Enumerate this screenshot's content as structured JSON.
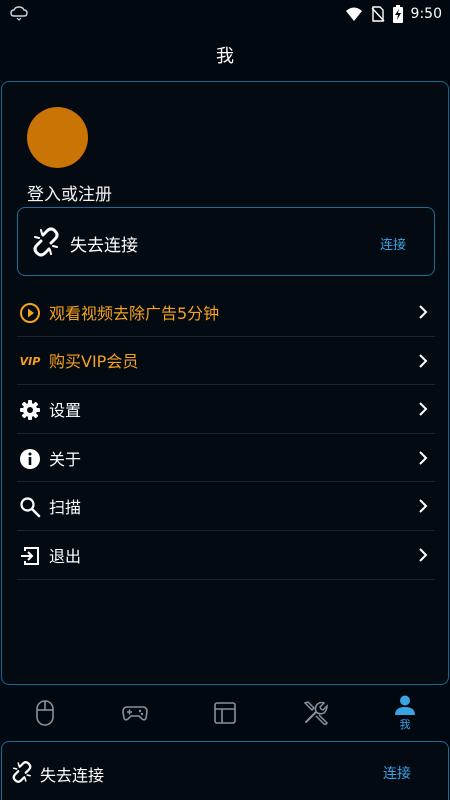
{
  "status_bar": {
    "time": "9:50"
  },
  "header": {
    "title": "我"
  },
  "profile": {
    "login_text": "登入或注册"
  },
  "connection": {
    "status": "失去连接",
    "action": "连接"
  },
  "menu": [
    {
      "label": "观看视频去除广告5分钟",
      "icon": "play-circle-icon",
      "color": "#f6a21c"
    },
    {
      "label": "购买VIP会员",
      "icon": "vip-icon",
      "color": "#f6a21c"
    },
    {
      "label": "设置",
      "icon": "gear-icon",
      "color": "#ffffff"
    },
    {
      "label": "关于",
      "icon": "info-icon",
      "color": "#ffffff"
    },
    {
      "label": "扫描",
      "icon": "search-icon",
      "color": "#ffffff"
    },
    {
      "label": "退出",
      "icon": "logout-icon",
      "color": "#ffffff"
    }
  ],
  "vip_badge": "VIP",
  "tabs": [
    {
      "icon": "mouse-icon",
      "label": ""
    },
    {
      "icon": "gamepad-icon",
      "label": ""
    },
    {
      "icon": "layout-icon",
      "label": ""
    },
    {
      "icon": "tools-icon",
      "label": ""
    },
    {
      "icon": "person-icon",
      "label": "我",
      "active": true
    }
  ],
  "bottom_bar": {
    "status": "失去连接",
    "action": "连接"
  },
  "colors": {
    "accent": "#3ba3e4",
    "orange": "#f6a21c",
    "avatar": "#c97404",
    "border": "#1c6f9a",
    "background": "#02080f"
  }
}
